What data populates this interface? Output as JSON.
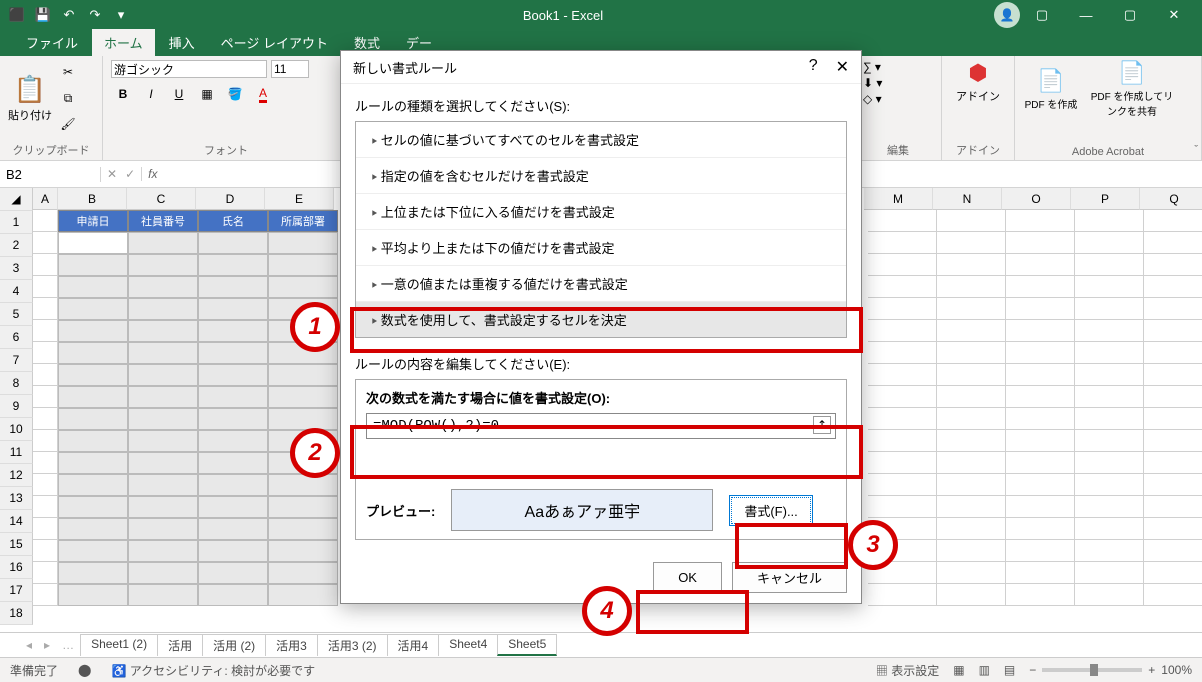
{
  "title": "Book1 - Excel",
  "qa": {
    "save": "💾",
    "undo": "↶",
    "redo": "↷"
  },
  "win": {
    "min": "—",
    "max": "▢",
    "close": "✕",
    "ribmin": "▢"
  },
  "tabs": [
    "ファイル",
    "ホーム",
    "挿入",
    "ページ レイアウト",
    "数式",
    "デー"
  ],
  "ribbon": {
    "clipboard": {
      "paste": "貼り付け",
      "label": "クリップボード"
    },
    "font": {
      "name": "游ゴシック",
      "size": "11",
      "label": "フォント",
      "bold": "B",
      "italic": "I",
      "underline": "U"
    },
    "editing": {
      "label": "編集"
    },
    "addin": {
      "btn": "アドイン",
      "label": "アドイン"
    },
    "acrobat": {
      "pdf1": "PDF を作成",
      "pdf2": "PDF を作成してリンクを共有",
      "label": "Adobe Acrobat"
    }
  },
  "namebox": "B2",
  "headers": {
    "B": "申請日",
    "C": "社員番号",
    "D": "氏名",
    "E": "所属部署"
  },
  "cols": [
    "A",
    "B",
    "C",
    "D",
    "E",
    "M",
    "N",
    "O",
    "P",
    "Q"
  ],
  "sheettabs": [
    "Sheet1 (2)",
    "活用",
    "活用 (2)",
    "活用3",
    "活用3 (2)",
    "活用4",
    "Sheet4",
    "Sheet5"
  ],
  "status": {
    "ready": "準備完了",
    "acc": "アクセシビリティ: 検討が必要です",
    "disp": "表示設定",
    "zoom": "100%"
  },
  "dialog": {
    "title": "新しい書式ルール",
    "help": "?",
    "close": "✕",
    "lbl_type": "ルールの種類を選択してください(S):",
    "rules": [
      "セルの値に基づいてすべてのセルを書式設定",
      "指定の値を含むセルだけを書式設定",
      "上位または下位に入る値だけを書式設定",
      "平均より上または下の値だけを書式設定",
      "一意の値または重複する値だけを書式設定",
      "数式を使用して、書式設定するセルを決定"
    ],
    "lbl_edit": "ルールの内容を編集してください(E):",
    "lbl_formula": "次の数式を満たす場合に値を書式設定(O):",
    "formula": "=MOD(ROW(),2)=0",
    "preview_lbl": "プレビュー:",
    "preview_txt": "Aaあぁアァ亜宇",
    "format_btn": "書式(F)...",
    "ok": "OK",
    "cancel": "キャンセル"
  }
}
